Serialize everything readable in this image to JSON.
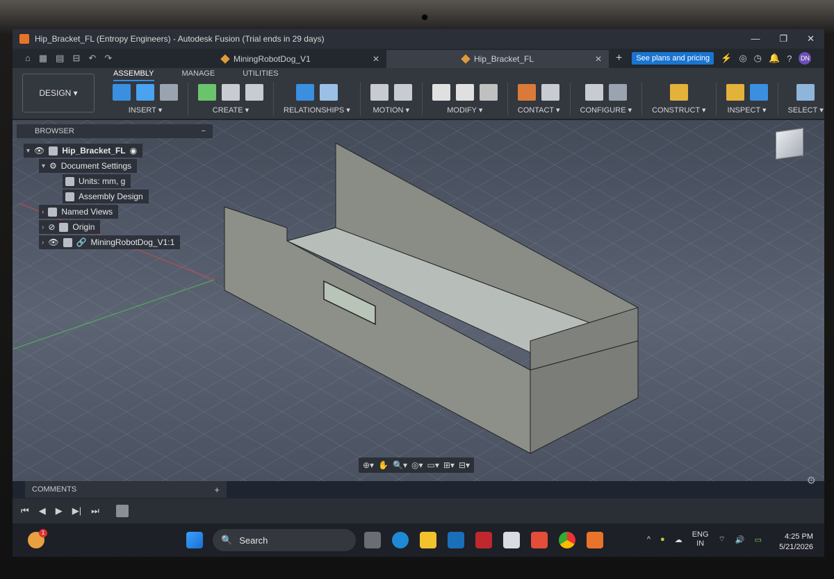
{
  "window": {
    "title": "Hip_Bracket_FL (Entropy Engineers) - Autodesk Fusion (Trial ends in 29 days)",
    "minimize": "—",
    "restore": "❐",
    "close": "✕"
  },
  "quick_access": [
    "⌂",
    "▦",
    "▤",
    "⊟",
    "↶",
    "↷"
  ],
  "tabs": [
    {
      "label": "MiningRobotDog_V1",
      "close": "✕"
    },
    {
      "label": "Hip_Bracket_FL",
      "close": "✕"
    }
  ],
  "new_tab": "+",
  "plans_button": "See plans and pricing",
  "top_icons": [
    "⚡",
    "◎",
    "◷",
    "🔔",
    "?"
  ],
  "user_initials": "DN",
  "workspace": "DESIGN ▾",
  "ribbon_tabs": [
    "ASSEMBLY",
    "MANAGE",
    "UTILITIES"
  ],
  "ribbon_groups": [
    {
      "label": "INSERT ▾",
      "icons": [
        "#3a8fe0",
        "#4aa3f0",
        "#9aa4b0"
      ]
    },
    {
      "label": "CREATE ▾",
      "icons": [
        "#6bc46b",
        "#c8ccd2",
        "#c8ccd2"
      ]
    },
    {
      "label": "RELATIONSHIPS ▾",
      "icons": [
        "#3a8fe0",
        "#9ac0e6"
      ]
    },
    {
      "label": "MOTION ▾",
      "icons": [
        "#c8ccd2",
        "#c8ccd2"
      ]
    },
    {
      "label": "MODIFY ▾",
      "icons": [
        "#e0e0e0",
        "#e0e0e0",
        "#c0c0c0"
      ]
    },
    {
      "label": "CONTACT ▾",
      "icons": [
        "#d97a3a",
        "#c8ccd2"
      ]
    },
    {
      "label": "CONFIGURE ▾",
      "icons": [
        "#c8ccd2",
        "#9aa4b0"
      ]
    },
    {
      "label": "CONSTRUCT ▾",
      "icons": [
        "#e2b23a"
      ]
    },
    {
      "label": "INSPECT ▾",
      "icons": [
        "#e2b23a",
        "#3a8fe0"
      ]
    },
    {
      "label": "SELECT ▾",
      "icons": [
        "#8fb6da"
      ]
    }
  ],
  "browser": {
    "header": "BROWSER",
    "collapse": "−",
    "root": "Hip_Bracket_FL",
    "doc_settings": "Document Settings",
    "units": "Units: mm, g",
    "assembly_design": "Assembly Design",
    "named_views": "Named Views",
    "origin": "Origin",
    "linked": "MiningRobotDog_V1:1"
  },
  "nav_toolbar": [
    "⊕▾",
    "✋",
    "🔍▾",
    "◎▾",
    "▭▾",
    "⊞▾",
    "⊟▾"
  ],
  "comments": {
    "label": "COMMENTS",
    "add": "+"
  },
  "timeline_controls": [
    "⏮",
    "◀",
    "▶",
    "▶|",
    "⏭"
  ],
  "taskbar": {
    "search_placeholder": "Search",
    "tray_lang_1": "ENG",
    "tray_lang_2": "IN",
    "time": "4:25 PM",
    "date": "5/21/2026",
    "notification_badge": "1"
  },
  "colors": {
    "accent": "#2f8fe8",
    "plans_bg": "#1a74d1",
    "model_face": "#8f918c",
    "model_inner": "#b8c0bc"
  }
}
